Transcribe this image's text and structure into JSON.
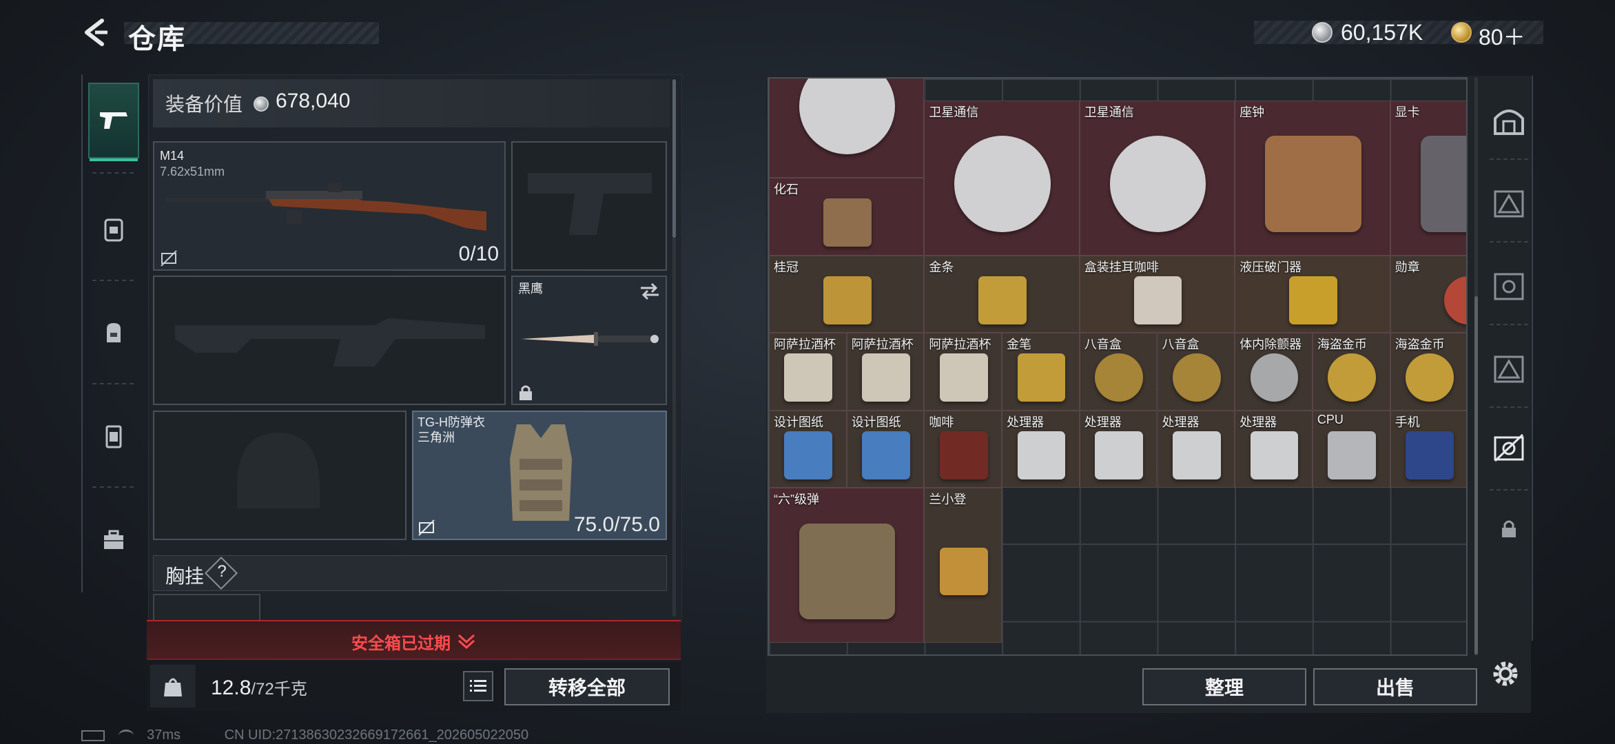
{
  "header": {
    "title": "仓库",
    "currency": [
      {
        "icon": "silver-coin-icon",
        "value": "60,157K"
      },
      {
        "icon": "gold-coin-icon",
        "value": "80＋"
      }
    ]
  },
  "left_nav": {
    "items": [
      {
        "name": "weapon-icon",
        "active": true
      },
      {
        "name": "backpack-rig-icon",
        "active": false
      },
      {
        "name": "bag-icon",
        "active": false
      },
      {
        "name": "container-icon",
        "active": false
      },
      {
        "name": "toolbox-icon",
        "active": false
      }
    ]
  },
  "equipment": {
    "value_label": "装备价值",
    "value": "678,040",
    "primary_weapon": {
      "name": "M14",
      "ammo": "7.62x51mm",
      "count": "0/10"
    },
    "melee": {
      "name": "黑鹰"
    },
    "armor": {
      "name": "TG-H防弹衣",
      "sub": "三角洲",
      "durability": "75.0/75.0"
    },
    "chest_rig_label": "胸挂",
    "help": "?"
  },
  "safe_box": {
    "status": "安全箱已过期"
  },
  "footer": {
    "weight": "12.8",
    "weight_cap": "/72千克",
    "transfer_all": "转移全部",
    "sort": "整理",
    "sell": "出售"
  },
  "status_bar": {
    "ping": "37ms",
    "uid": "CN UID:27138630232669172661_202605022050"
  },
  "storage_items": [
    {
      "name": "",
      "type": "satellite"
    },
    {
      "name": "卫星通信",
      "type": "satellite"
    },
    {
      "name": "卫星通信",
      "type": "satellite"
    },
    {
      "name": "座钟",
      "type": "clock"
    },
    {
      "name": "显卡",
      "type": "gpu"
    },
    {
      "name": "化石",
      "type": "fossil"
    },
    {
      "name": "桂冠",
      "type": "laurel"
    },
    {
      "name": "金条",
      "type": "goldbar"
    },
    {
      "name": "盒装挂耳咖啡",
      "type": "coffeebox"
    },
    {
      "name": "液压破门器",
      "type": "breacher"
    },
    {
      "name": "勋章",
      "type": "medal"
    },
    {
      "name": "阿萨拉酒杯",
      "type": "cup"
    },
    {
      "name": "阿萨拉酒杯",
      "type": "cup"
    },
    {
      "name": "阿萨拉酒杯",
      "type": "cup"
    },
    {
      "name": "金笔",
      "type": "pen"
    },
    {
      "name": "八音盒",
      "type": "musicbox"
    },
    {
      "name": "八音盒",
      "type": "musicbox"
    },
    {
      "name": "体内除颤器",
      "type": "defib"
    },
    {
      "name": "海盗金币",
      "type": "coin"
    },
    {
      "name": "海盗金币",
      "type": "coin"
    },
    {
      "name": "设计图纸",
      "type": "blueprint"
    },
    {
      "name": "设计图纸",
      "type": "blueprint"
    },
    {
      "name": "咖啡",
      "type": "coffee"
    },
    {
      "name": "处理器",
      "type": "processor"
    },
    {
      "name": "处理器",
      "type": "processor"
    },
    {
      "name": "处理器",
      "type": "processor"
    },
    {
      "name": "处理器",
      "type": "processor"
    },
    {
      "name": "CPU",
      "type": "cpu"
    },
    {
      "name": "手机",
      "type": "phone"
    },
    {
      "name": "“六”级弹",
      "type": "hand"
    },
    {
      "name": "兰小登",
      "type": "figure"
    }
  ],
  "colors": {
    "accent_green": "#36c2a2",
    "warning_red": "#ff4b4f",
    "rare_red_bg": "#4a2a30",
    "gold_bg": "#3f3630"
  }
}
